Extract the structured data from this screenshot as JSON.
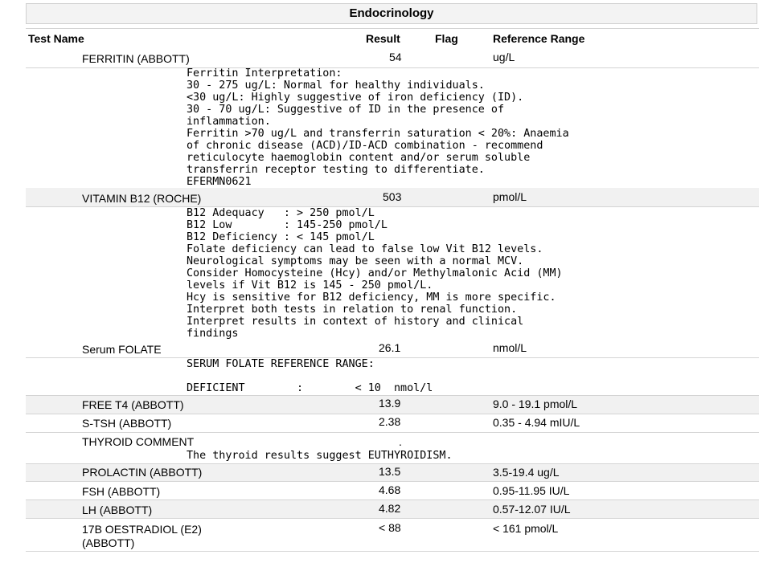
{
  "section": {
    "title": "Endocrinology"
  },
  "columns": {
    "test_name": "Test Name",
    "result": "Result",
    "flag": "Flag",
    "reference_range": "Reference Range"
  },
  "rows": [
    {
      "name": "FERRITIN (ABBOTT)",
      "result": "54",
      "flag": "",
      "range": "ug/L"
    },
    {
      "name": "VITAMIN B12 (ROCHE)",
      "result": "503",
      "flag": "",
      "range": "pmol/L"
    },
    {
      "name": "Serum FOLATE",
      "result": "26.1",
      "flag": "",
      "range": "nmol/L"
    },
    {
      "name": "FREE T4 (ABBOTT)",
      "result": "13.9",
      "flag": "",
      "range": "9.0 - 19.1 pmol/L"
    },
    {
      "name": "S-TSH (ABBOTT)",
      "result": "2.38",
      "flag": "",
      "range": "0.35 - 4.94 mIU/L"
    },
    {
      "name": "THYROID COMMENT",
      "result": ".",
      "flag": "",
      "range": ""
    },
    {
      "name": "PROLACTIN (ABBOTT)",
      "result": "13.5",
      "flag": "",
      "range": "3.5-19.4 ug/L"
    },
    {
      "name": "FSH (ABBOTT)",
      "result": "4.68",
      "flag": "",
      "range": "0.95-11.95 IU/L"
    },
    {
      "name": "LH (ABBOTT)",
      "result": "4.82",
      "flag": "",
      "range": "0.57-12.07 IU/L"
    },
    {
      "name": "17B OESTRADIOL (E2)\n(ABBOTT)",
      "result": "< 88",
      "flag": "",
      "range": "< 161 pmol/L"
    }
  ],
  "comments": {
    "ferritin": "Ferritin Interpretation:\n30 - 275 ug/L: Normal for healthy individuals.\n<30 ug/L: Highly suggestive of iron deficiency (ID).\n30 - 70 ug/L: Suggestive of ID in the presence of\ninflammation.\nFerritin >70 ug/L and transferrin saturation < 20%: Anaemia\nof chronic disease (ACD)/ID-ACD combination - recommend\nreticulocyte haemoglobin content and/or serum soluble\ntransferrin receptor testing to differentiate.\nEFERMN0621",
    "b12": "B12 Adequacy   : > 250 pmol/L\nB12 Low        : 145-250 pmol/L\nB12 Deficiency : < 145 pmol/L\nFolate deficiency can lead to false low Vit B12 levels.\nNeurological symptoms may be seen with a normal MCV.\nConsider Homocysteine (Hcy) and/or Methylmalonic Acid (MM)\nlevels if Vit B12 is 145 - 250 pmol/L.\nHcy is sensitive for B12 deficiency, MM is more specific.\nInterpret both tests in relation to renal function.\nInterpret results in context of history and clinical\nfindings",
    "folate": "SERUM FOLATE REFERENCE RANGE:\n\nDEFICIENT        :        < 10  nmol/l",
    "thyroid": "The thyroid results suggest EUTHYROIDISM."
  }
}
